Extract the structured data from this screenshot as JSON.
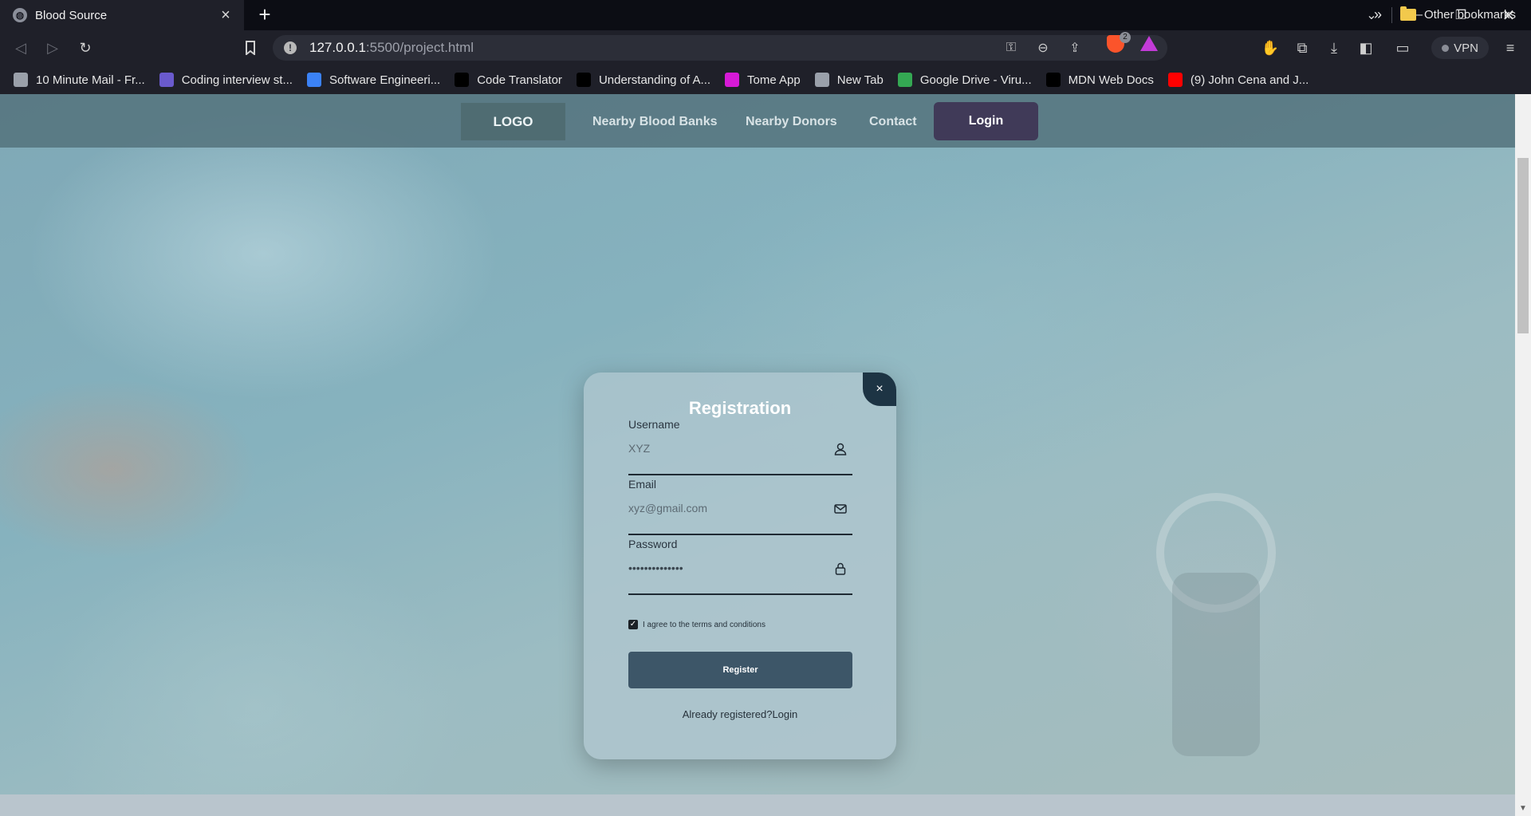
{
  "browser": {
    "tab_title": "Blood Source",
    "url_host": "127.0.0.1",
    "url_rest": ":5500/project.html",
    "shields_count": "2",
    "vpn_label": "VPN"
  },
  "bookmarks": [
    {
      "label": "10 Minute Mail - Fr...",
      "icon": "mail-globe-icon",
      "color": "#9aa0aa"
    },
    {
      "label": "Coding interview st...",
      "icon": "code-icon",
      "color": "#6a5acd"
    },
    {
      "label": "Software Engineeri...",
      "icon": "at-icon",
      "color": "#3b82f6"
    },
    {
      "label": "Code Translator",
      "icon": "triangle-icon",
      "color": "#000000"
    },
    {
      "label": "Understanding of A...",
      "icon": "medium-icon",
      "color": "#000000"
    },
    {
      "label": "Tome App",
      "icon": "ring-icon",
      "color": "#d61ad6"
    },
    {
      "label": "New Tab",
      "icon": "globe-icon",
      "color": "#9aa0aa"
    },
    {
      "label": "Google Drive - Viru...",
      "icon": "drive-icon",
      "color": "#34a853"
    },
    {
      "label": "MDN Web Docs",
      "icon": "mdn-icon",
      "color": "#000000"
    },
    {
      "label": "(9) John Cena and J...",
      "icon": "youtube-icon",
      "color": "#ff0000"
    }
  ],
  "other_bookmarks": "Other bookmarks",
  "nav": {
    "logo": "LOGO",
    "links": [
      "Nearby Blood Banks",
      "Nearby Donors",
      "Contact"
    ],
    "login": "Login"
  },
  "form": {
    "title": "Registration",
    "close": "×",
    "username_label": "Username",
    "username_value": "XYZ",
    "email_label": "Email",
    "email_value": "xyz@gmail.com",
    "password_label": "Password",
    "password_value": "••••••••••••••",
    "terms": "I agree to the terms and conditions",
    "terms_checked": true,
    "register": "Register",
    "already_prefix": "Already registered?",
    "already_link": "Login"
  },
  "colors": {
    "nav_login_bg": "#403a58",
    "register_bg": "#3d5668",
    "close_bg": "#1d3444"
  }
}
